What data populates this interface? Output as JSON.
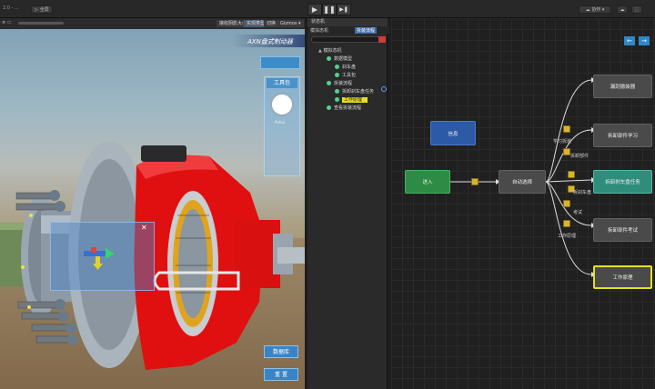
{
  "toolbar": {
    "left_text": "2.0 - ...",
    "left_button": "▷ 全屏",
    "play_icons": [
      "▶",
      "❚❚",
      "▶❚"
    ],
    "right_button": "☁ 协作 ▾",
    "right_icons": [
      "☁",
      "⬚"
    ]
  },
  "scene": {
    "tab_left": "≡ ▭",
    "tabs": [
      "接收阴影大小",
      "实现类型",
      "切换",
      "Gizmos ▾"
    ],
    "title": "AXN盘式制动器",
    "top_right_button": "",
    "toolbox_title": "工具包",
    "toolbox_caption": "Puhui",
    "popup_close": "✕",
    "bottom_buttons": [
      "数据库",
      "重 置"
    ]
  },
  "hierarchy": {
    "tabs": [
      "状态机"
    ],
    "subtabs": [
      "模拟态机",
      "拆装流程"
    ],
    "search_placeholder": "",
    "tree": [
      {
        "label": "模拟态机",
        "depth": 0,
        "dot": false,
        "selected": false
      },
      {
        "label": "数据模型",
        "depth": 1,
        "dot": true,
        "selected": false
      },
      {
        "label": "刹车盘",
        "depth": 2,
        "dot": true,
        "selected": false
      },
      {
        "label": "工具包",
        "depth": 2,
        "dot": true,
        "selected": false
      },
      {
        "label": "拆装流程",
        "depth": 1,
        "dot": true,
        "selected": false
      },
      {
        "label": "拆卸刹车盘任务",
        "depth": 2,
        "dot": true,
        "selected": false
      },
      {
        "label": "工作原理",
        "depth": 2,
        "dot": true,
        "selected": true
      },
      {
        "label": "查看拆装流程",
        "depth": 1,
        "dot": true,
        "selected": false
      }
    ]
  },
  "graph": {
    "nav_icons": [
      "←",
      "→"
    ],
    "nodes": {
      "info": "信息",
      "enter": "进入",
      "autoselect": "自动选择",
      "n1": "漏刮撤装器",
      "n2": "拆卸部件学习",
      "n3": "拆卸刹车盘任务",
      "n4": "拆卸部件考试",
      "n5": "工作原理"
    },
    "edge_labels": [
      "学习拆装",
      "拆卸部件",
      "拆刹车盘",
      "考试",
      "工作原理"
    ]
  },
  "colors": {
    "accent_yellow": "#e8c830",
    "node_green": "#2e8b46",
    "node_blue": "#2d5aa6",
    "node_teal": "#2f8d7c",
    "selected_yellow": "#e6e020"
  }
}
